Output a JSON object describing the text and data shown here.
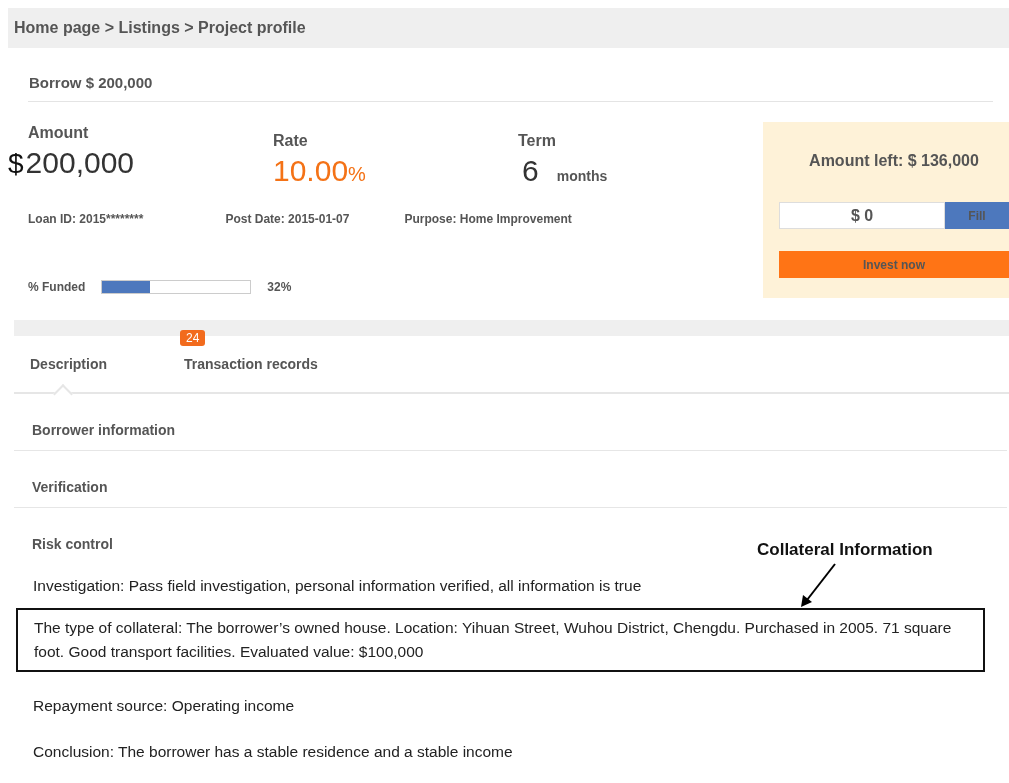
{
  "breadcrumb": "Home page > Listings > Project profile",
  "title": "Borrow $ 200,000",
  "stats": [
    {
      "label": "Amount",
      "prefix": "$",
      "value": "200,000",
      "kind": "amount"
    },
    {
      "label": "Rate",
      "value": "10.00",
      "unit": "%",
      "kind": "rate"
    },
    {
      "label": "Term",
      "value": "6",
      "unit": "months",
      "kind": "term"
    }
  ],
  "details": [
    "Loan ID: 2015********",
    "Post Date: 2015-01-07",
    "Purpose: Home Improvement"
  ],
  "funded": {
    "label": "% Funded",
    "level": 0.32,
    "reading": "32%"
  },
  "invest_box": {
    "amount_left": "Amount left: $ 136,000",
    "amount_field": {
      "value": "$ 0"
    },
    "fill_button": "Fill",
    "invest_button": "Invest now"
  },
  "tabs": [
    {
      "label": "Description",
      "selected": true
    },
    {
      "label": "Transaction records",
      "selected": false,
      "badge": "24"
    }
  ],
  "sections": [
    "Borrower information",
    "Verification",
    "Risk control"
  ],
  "paragraphs": [
    {
      "text": "Investigation: Pass field investigation, personal information verified, all information is true",
      "boxed": false
    },
    {
      "text": "The type of collateral: The borrower’s owned house. Location: Yihuan Street, Wuhou District, Chengdu. Purchased in 2005. 71 square foot. Good transport facilities. Evaluated value: $100,000",
      "boxed": true
    },
    {
      "text": "Repayment source: Operating income",
      "boxed": false
    },
    {
      "text": "Conclusion: The borrower has a stable residence and a stable income",
      "boxed": false
    }
  ],
  "annotation": "Collateral Information"
}
